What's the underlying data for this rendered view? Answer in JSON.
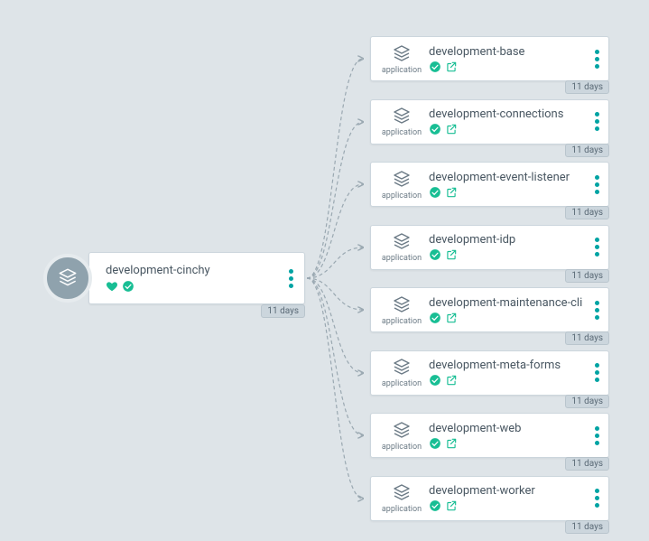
{
  "root": {
    "title": "development-cinchy",
    "age": "11 days"
  },
  "child_icon_label": "application",
  "children": [
    {
      "title": "development-base",
      "age": "11 days"
    },
    {
      "title": "development-connections",
      "age": "11 days"
    },
    {
      "title": "development-event-listener",
      "age": "11 days"
    },
    {
      "title": "development-idp",
      "age": "11 days"
    },
    {
      "title": "development-maintenance-cli",
      "age": "11 days"
    },
    {
      "title": "development-meta-forms",
      "age": "11 days"
    },
    {
      "title": "development-web",
      "age": "11 days"
    },
    {
      "title": "development-worker",
      "age": "11 days"
    }
  ],
  "colors": {
    "accent": "#18BE94",
    "teal": "#00a3a3"
  }
}
